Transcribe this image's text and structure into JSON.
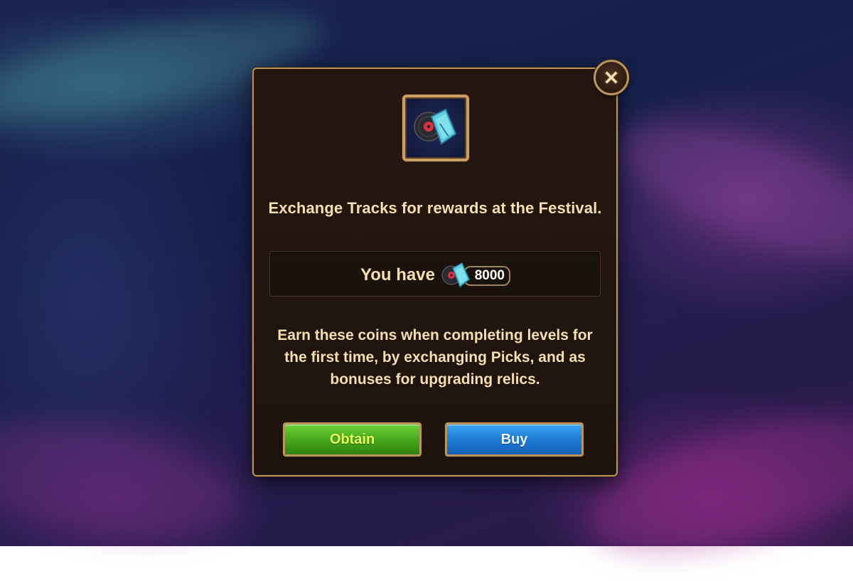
{
  "dialog": {
    "title": "Exchange Tracks for rewards at the Festival.",
    "have_label": "You have",
    "currency_icon": "tracks-currency-icon",
    "count": "8000",
    "description": "Earn these coins when completing levels for the first time, by exchanging Picks, and as bonuses for upgrading relics.",
    "close_icon": "close-icon"
  },
  "buttons": {
    "obtain_label": "Obtain",
    "buy_label": "Buy"
  },
  "colors": {
    "accent_gold": "#b9955e",
    "text_cream": "#f6dfae",
    "obtain_green": "#4aac1e",
    "buy_blue": "#1f7fd6"
  }
}
